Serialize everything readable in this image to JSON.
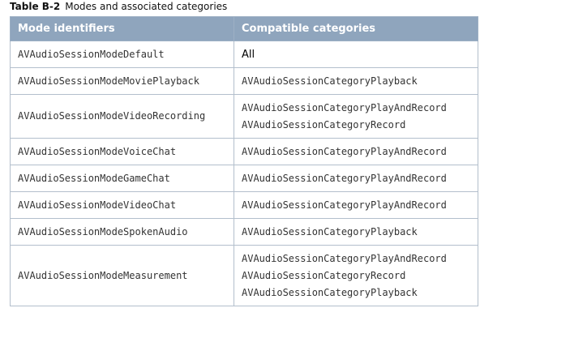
{
  "caption": {
    "label": "Table B-2",
    "text": "Modes and associated categories"
  },
  "table": {
    "headers": [
      "Mode identifiers",
      "Compatible categories"
    ],
    "rows": [
      {
        "mode": "AVAudioSessionModeDefault",
        "categories": [
          "All"
        ]
      },
      {
        "mode": "AVAudioSessionModeMoviePlayback",
        "categories": [
          "AVAudioSessionCategoryPlayback"
        ]
      },
      {
        "mode": "AVAudioSessionModeVideoRecording",
        "categories": [
          "AVAudioSessionCategoryPlayAndRecord",
          "AVAudioSessionCategoryRecord"
        ]
      },
      {
        "mode": "AVAudioSessionModeVoiceChat",
        "categories": [
          "AVAudioSessionCategoryPlayAndRecord"
        ]
      },
      {
        "mode": "AVAudioSessionModeGameChat",
        "categories": [
          "AVAudioSessionCategoryPlayAndRecord"
        ]
      },
      {
        "mode": "AVAudioSessionModeVideoChat",
        "categories": [
          "AVAudioSessionCategoryPlayAndRecord"
        ]
      },
      {
        "mode": "AVAudioSessionModeSpokenAudio",
        "categories": [
          "AVAudioSessionCategoryPlayback"
        ]
      },
      {
        "mode": "AVAudioSessionModeMeasurement",
        "categories": [
          "AVAudioSessionCategoryPlayAndRecord",
          "AVAudioSessionCategoryRecord",
          "AVAudioSessionCategoryPlayback"
        ]
      }
    ]
  }
}
